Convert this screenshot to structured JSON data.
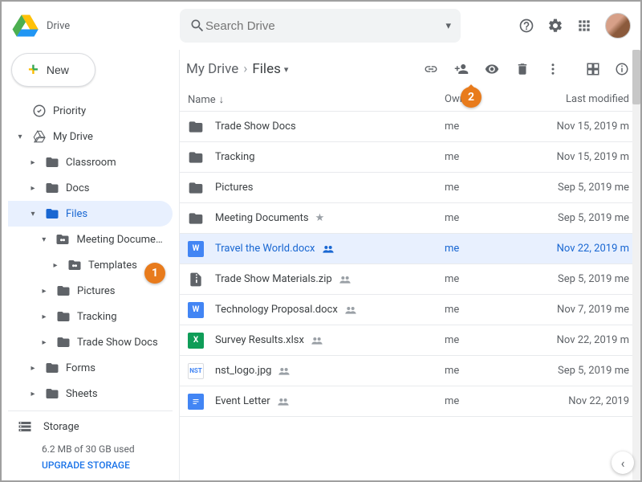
{
  "header": {
    "app_name": "Drive",
    "search_placeholder": "Search Drive"
  },
  "sidebar": {
    "new_label": "New",
    "priority": "Priority",
    "my_drive": "My Drive",
    "tree": {
      "classroom": "Classroom",
      "docs": "Docs",
      "files": "Files",
      "meeting_docs": "Meeting Documen...",
      "templates": "Templates",
      "pictures": "Pictures",
      "tracking": "Tracking",
      "trade_show": "Trade Show Docs",
      "forms": "Forms",
      "sheets": "Sheets"
    },
    "storage": {
      "label": "Storage",
      "used": "6.2 MB of 30 GB used",
      "upgrade": "UPGRADE STORAGE"
    }
  },
  "breadcrumb": {
    "root": "My Drive",
    "current": "Files"
  },
  "columns": {
    "name": "Name",
    "owner": "Owner",
    "modified": "Last modified"
  },
  "files": [
    {
      "type": "folder",
      "name": "Trade Show Docs",
      "owner": "me",
      "modified": "Nov 15, 2019 m"
    },
    {
      "type": "folder",
      "name": "Tracking",
      "owner": "me",
      "modified": "Nov 15, 2019 m"
    },
    {
      "type": "folder",
      "name": "Pictures",
      "owner": "me",
      "modified": "Sep 5, 2019 me"
    },
    {
      "type": "folder",
      "name": "Meeting Documents",
      "owner": "me",
      "modified": "Sep 5, 2019 me",
      "starred": true
    },
    {
      "type": "docx",
      "name": "Travel the World.docx",
      "owner": "me",
      "modified": "Nov 22, 2019 m",
      "selected": true,
      "shared": true
    },
    {
      "type": "zip",
      "name": "Trade Show Materials.zip",
      "owner": "me",
      "modified": "Sep 5, 2019 me",
      "shared": true
    },
    {
      "type": "docx",
      "name": "Technology Proposal.docx",
      "owner": "me",
      "modified": "Nov 7, 2019 me",
      "shared": true
    },
    {
      "type": "xlsx",
      "name": "Survey Results.xlsx",
      "owner": "me",
      "modified": "Nov 22, 2019 m",
      "shared": true
    },
    {
      "type": "img",
      "name": "nst_logo.jpg",
      "owner": "me",
      "modified": "Sep 5, 2019 me",
      "shared": true
    },
    {
      "type": "gdoc",
      "name": "Event Letter",
      "owner": "me",
      "modified": "Nov 22, 2019",
      "shared": true
    }
  ],
  "annotations": {
    "step1": "1",
    "step2": "2"
  }
}
